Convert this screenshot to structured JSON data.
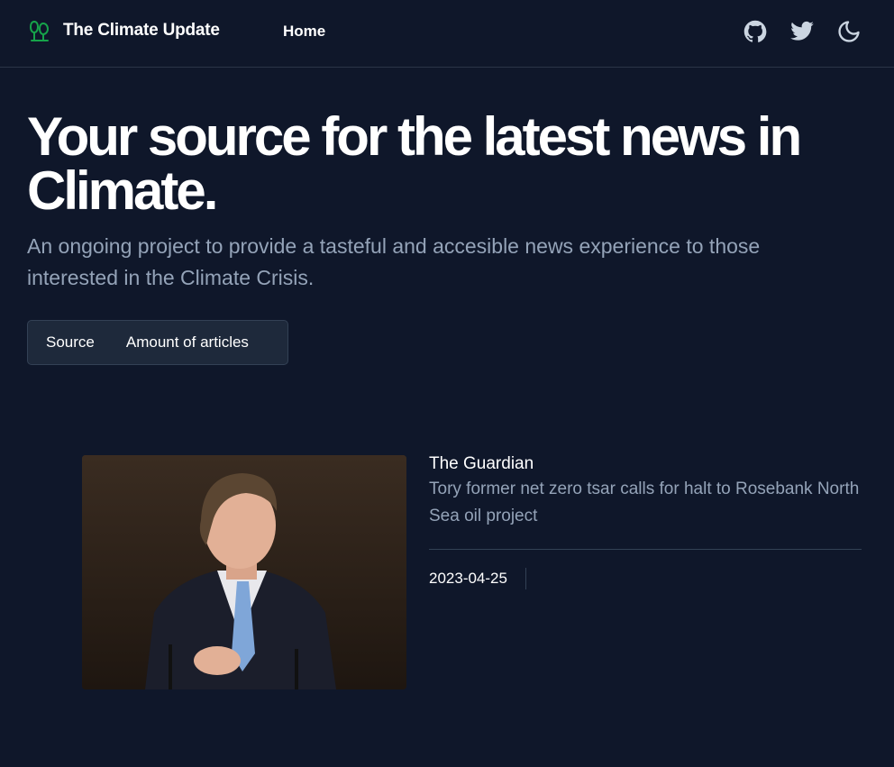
{
  "header": {
    "brand_name": "The Climate Update",
    "nav_home": "Home",
    "icons": [
      "trees-icon",
      "github-icon",
      "twitter-icon",
      "moon-icon"
    ],
    "brand_color": "#16a34a"
  },
  "hero": {
    "title": "Your source for the latest news in Climate.",
    "subtitle": "An ongoing project to provide a tasteful and accesible news experience to those interested in the Climate Crisis."
  },
  "sort": {
    "source_label": "Source",
    "amount_label": "Amount of articles"
  },
  "articles": [
    {
      "source": "The Guardian",
      "headline": "Tory former net zero tsar calls for halt to Rosebank North Sea oil project",
      "date": "2023-04-25"
    }
  ],
  "colors": {
    "background": "#0f172a",
    "muted_text": "#94a3b8",
    "panel": "#1e293b",
    "border": "#334155"
  }
}
